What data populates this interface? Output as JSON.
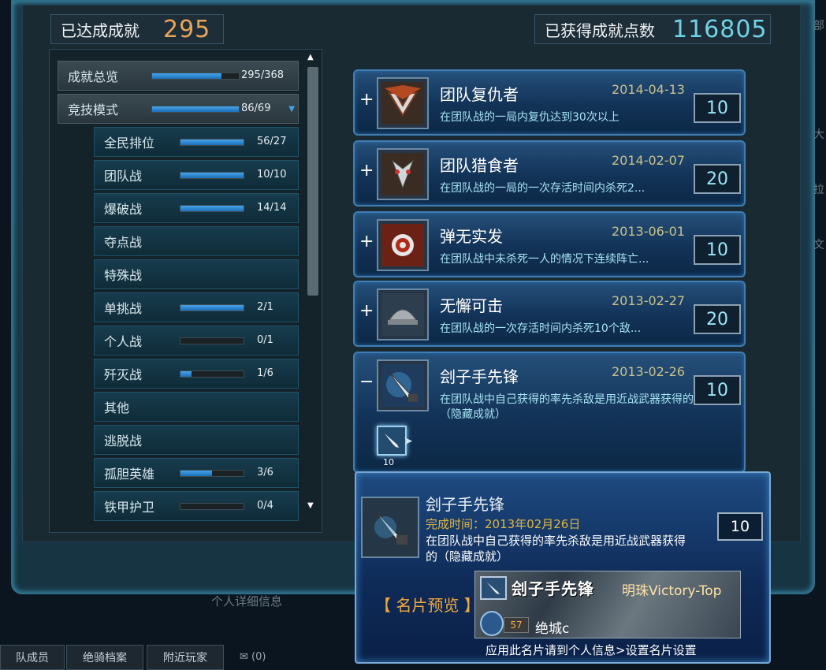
{
  "header": {
    "achieved_label": "已达成成就",
    "achieved_value": "295",
    "points_label": "已获得成就点数",
    "points_value": "116805"
  },
  "tree": {
    "items": [
      {
        "name": "成就总览",
        "count": "295/368",
        "progress": 0.8,
        "level": "top"
      },
      {
        "name": "竞技模式",
        "count": "86/69",
        "progress": 1.0,
        "level": "top",
        "expanded": true
      },
      {
        "name": "全民排位",
        "count": "56/27",
        "progress": 1.0,
        "level": "sub"
      },
      {
        "name": "团队战",
        "count": "10/10",
        "progress": 1.0,
        "level": "sub"
      },
      {
        "name": "爆破战",
        "count": "14/14",
        "progress": 1.0,
        "level": "sub"
      },
      {
        "name": "夺点战",
        "count": "",
        "progress": null,
        "level": "sub"
      },
      {
        "name": "特殊战",
        "count": "",
        "progress": null,
        "level": "sub"
      },
      {
        "name": "单挑战",
        "count": "2/1",
        "progress": 1.0,
        "level": "sub"
      },
      {
        "name": "个人战",
        "count": "0/1",
        "progress": 0.0,
        "level": "sub"
      },
      {
        "name": "歼灭战",
        "count": "1/6",
        "progress": 0.17,
        "level": "sub"
      },
      {
        "name": "其他",
        "count": "",
        "progress": null,
        "level": "sub"
      },
      {
        "name": "逃脱战",
        "count": "",
        "progress": null,
        "level": "sub"
      },
      {
        "name": "孤胆英雄",
        "count": "3/6",
        "progress": 0.5,
        "level": "sub"
      },
      {
        "name": "铁甲护卫",
        "count": "0/4",
        "progress": 0.0,
        "level": "sub"
      }
    ]
  },
  "achievements": [
    {
      "toggle": "+",
      "title": "团队复仇者",
      "date": "2014-04-13",
      "desc": "在团队战的一局内复仇达到30次以上",
      "points": "10"
    },
    {
      "toggle": "+",
      "title": "团队猎食者",
      "date": "2014-02-07",
      "desc": "在团队战的一局的一次存活时间内杀死2...",
      "points": "20"
    },
    {
      "toggle": "+",
      "title": "弹无实发",
      "date": "2013-06-01",
      "desc": "在团队战中未杀死一人的情况下连续阵亡...",
      "points": "10"
    },
    {
      "toggle": "+",
      "title": "无懈可击",
      "date": "2013-02-27",
      "desc": "在团队战的一次存活时间内杀死10个敌...",
      "points": "20"
    },
    {
      "toggle": "−",
      "title": "刽子手先锋",
      "date": "2013-02-26",
      "desc": "在团队战中自己获得的率先杀敌是用近战武器获得的（隐藏成就）",
      "points": "10",
      "badge_points": "10"
    }
  ],
  "tooltip": {
    "title": "刽子手先锋",
    "time": "完成时间：2013年02月26日",
    "desc": "在团队战中自己获得的率先杀敌是用近战武器获得的（隐藏成就）",
    "points": "10",
    "preview_label": "【 名片预览 】",
    "card_title": "刽子手先锋",
    "card_name": "明珠Victory-Top",
    "card_level": "57",
    "card_user": "绝城c",
    "hint": "应用此名片请到个人信息>设置名片设置"
  },
  "background": {
    "personal_link": "个人详细信息",
    "tabs": [
      "队成员",
      "绝骑档案",
      "附近玩家"
    ],
    "mail": "(0)",
    "side_glyphs": [
      "部",
      "大",
      "拉",
      "文"
    ]
  },
  "colors": {
    "accent_orange": "#e8a45a",
    "accent_cyan": "#6fd3e6",
    "bar_blue": "#2a86d1",
    "card_blue": "#123257"
  }
}
